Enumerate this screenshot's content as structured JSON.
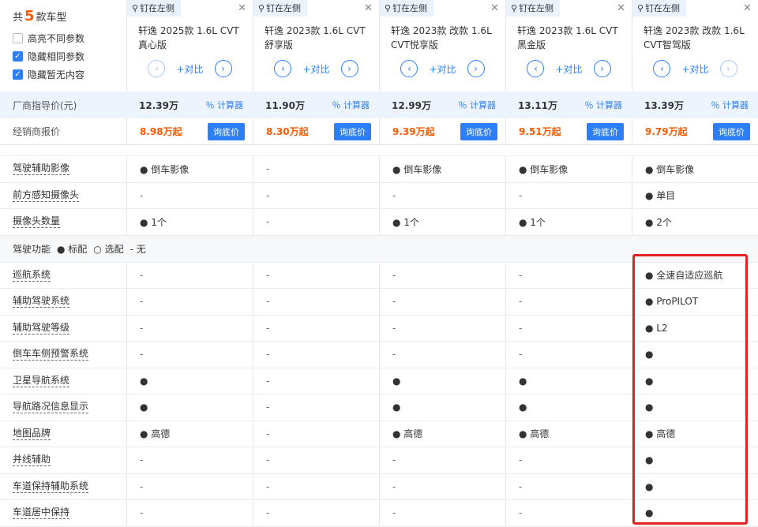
{
  "header": {
    "count_prefix": "共",
    "count": "5",
    "count_suffix": "款车型",
    "options": [
      {
        "label": "高亮不同参数",
        "checked": false
      },
      {
        "label": "隐藏相同参数",
        "checked": true
      },
      {
        "label": "隐藏暂无内容",
        "checked": true
      }
    ],
    "pin_label": "钉在左侧",
    "add_label": "+对比"
  },
  "cars": [
    {
      "name": "轩逸 2025款 1.6L CVT真心版",
      "msrp": "12.39万",
      "dealer": "8.98万起"
    },
    {
      "name": "轩逸 2023款 1.6L CVT舒享版",
      "msrp": "11.90万",
      "dealer": "8.30万起"
    },
    {
      "name": "轩逸 2023款 改款 1.6L CVT悦享版",
      "msrp": "12.99万",
      "dealer": "9.39万起"
    },
    {
      "name": "轩逸 2023款 1.6L CVT黑金版",
      "msrp": "13.11万",
      "dealer": "9.51万起"
    },
    {
      "name": "轩逸 2023款 改款 1.6L CVT智驾版",
      "msrp": "13.39万",
      "dealer": "9.79万起"
    }
  ],
  "price_row": {
    "label": "厂商指导价(元)",
    "calc": "计算器"
  },
  "dealer_row": {
    "label": "经销商报价",
    "inquiry": "询底价"
  },
  "rows_top": [
    {
      "label": "驾驶辅助影像",
      "values": [
        "● 倒车影像",
        "-",
        "● 倒车影像",
        "● 倒车影像",
        "● 倒车影像"
      ]
    },
    {
      "label": "前方感知摄像头",
      "values": [
        "-",
        "-",
        "-",
        "-",
        "● 单目"
      ]
    },
    {
      "label": "摄像头数量",
      "values": [
        "● 1个",
        "-",
        "● 1个",
        "● 1个",
        "● 2个"
      ]
    }
  ],
  "section": {
    "title": "驾驶功能",
    "std": "● 标配",
    "opt": "○ 选配",
    "none": "- 无"
  },
  "rows_bottom": [
    {
      "label": "巡航系统",
      "values": [
        "-",
        "-",
        "-",
        "-",
        "● 全速自适应巡航"
      ]
    },
    {
      "label": "辅助驾驶系统",
      "values": [
        "-",
        "-",
        "-",
        "-",
        "● ProPILOT"
      ]
    },
    {
      "label": "辅助驾驶等级",
      "values": [
        "-",
        "-",
        "-",
        "-",
        "● L2"
      ]
    },
    {
      "label": "倒车车侧预警系统",
      "values": [
        "-",
        "-",
        "-",
        "-",
        "●"
      ]
    },
    {
      "label": "卫星导航系统",
      "values": [
        "●",
        "-",
        "●",
        "●",
        "●"
      ]
    },
    {
      "label": "导航路况信息显示",
      "values": [
        "●",
        "-",
        "●",
        "●",
        "●"
      ]
    },
    {
      "label": "地图品牌",
      "values": [
        "● 高德",
        "-",
        "● 高德",
        "● 高德",
        "● 高德"
      ]
    },
    {
      "label": "并线辅助",
      "values": [
        "-",
        "-",
        "-",
        "-",
        "●"
      ]
    },
    {
      "label": "车道保持辅助系统",
      "values": [
        "-",
        "-",
        "-",
        "-",
        "●"
      ]
    },
    {
      "label": "车道居中保持",
      "values": [
        "-",
        "-",
        "-",
        "-",
        "●"
      ]
    }
  ]
}
